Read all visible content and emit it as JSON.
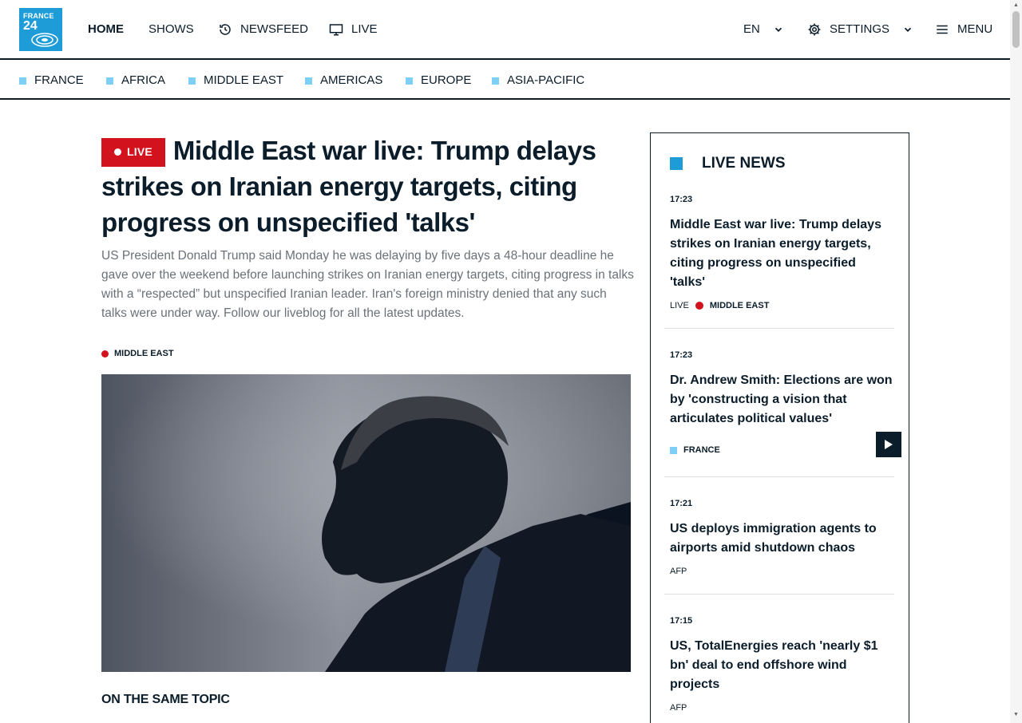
{
  "brand": {
    "logo_line1": "FRANCE",
    "logo_line2": "24",
    "color": "#1d9cd8"
  },
  "header": {
    "nav": [
      {
        "label": "HOME",
        "active": true
      },
      {
        "label": "SHOWS"
      },
      {
        "label": "NEWSFEED",
        "icon": "history-icon"
      },
      {
        "label": "LIVE",
        "icon": "tv-icon"
      }
    ],
    "language": {
      "label": "EN",
      "icon": "chevron-down-icon"
    },
    "settings": {
      "label": "SETTINGS",
      "icon": "gear-icon"
    },
    "menu": {
      "label": "MENU",
      "icon": "hamburger-icon"
    }
  },
  "regions": [
    "FRANCE",
    "AFRICA",
    "MIDDLE EAST",
    "AMERICAS",
    "EUROPE",
    "ASIA-PACIFIC"
  ],
  "article": {
    "live_badge": "LIVE",
    "headline": "Middle East war live: Trump delays strikes on Iranian energy targets, citing progress on unspecified 'talks'",
    "summary": "US President Donald Trump said Monday he was delaying by five days a 48-hour deadline he gave over the weekend before launching strikes on Iranian energy targets, citing progress in talks with a “respected” but unspecified Iranian leader. Iran's foreign ministry denied that any such talks were under way. Follow our liveblog for all the latest updates.",
    "tag": "MIDDLE EAST",
    "same_topic": "ON THE SAME TOPIC"
  },
  "live_news": {
    "title": "LIVE NEWS",
    "items": [
      {
        "time": "17:23",
        "title": "Middle East war live: Trump delays strikes on Iranian energy targets, citing progress on unspecified 'talks'",
        "prefix": "LIVE",
        "tag": "MIDDLE EAST"
      },
      {
        "time": "17:23",
        "title": "Dr. Andrew Smith: Elections are won by 'constructing a vision that articulates political values'",
        "tag": "FRANCE"
      },
      {
        "time": "17:21",
        "title": "US deploys immigration agents to airports amid shutdown chaos",
        "source": "AFP"
      },
      {
        "time": "17:15",
        "title": "US, TotalEnergies reach 'nearly $1 bn' deal to end offshore wind projects",
        "source": "AFP"
      }
    ]
  },
  "colors": {
    "live_red": "#d2121d",
    "navy": "#0b1d2a",
    "region_square": "#7dcff5"
  }
}
